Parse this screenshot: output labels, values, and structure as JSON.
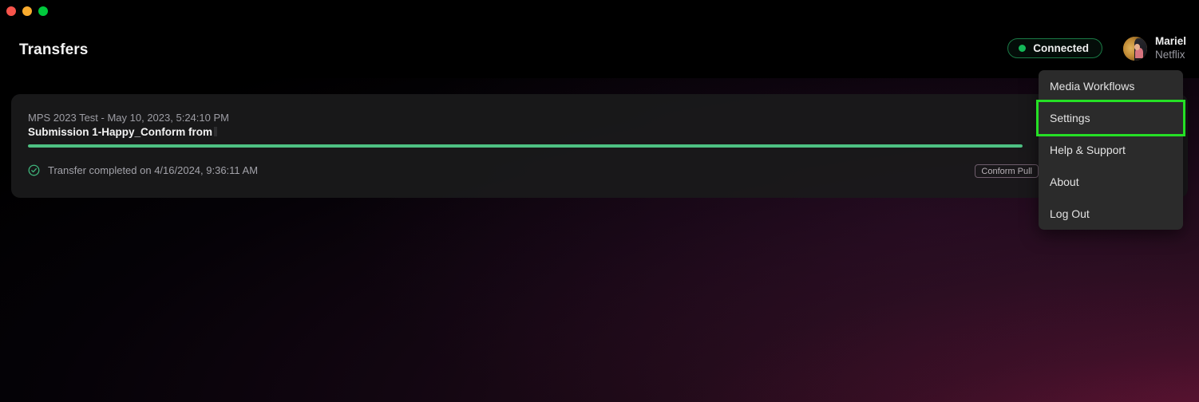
{
  "window": {
    "traffic_lights": [
      {
        "name": "close",
        "color": "#f8544b"
      },
      {
        "name": "minimize",
        "color": "#f9ab2e"
      },
      {
        "name": "zoom",
        "color": "#00c93c"
      }
    ]
  },
  "header": {
    "title": "Transfers",
    "connection": {
      "label": "Connected",
      "status_color": "#14b858",
      "border_color": "#1a7a45"
    },
    "user": {
      "name": "Mariel",
      "organization": "Netflix",
      "avatar_icon": "user-avatar-photo"
    }
  },
  "transfers": [
    {
      "meta": "MPS 2023 Test - May 10, 2023, 5:24:10 PM",
      "title": "Submission 1-Happy_Conform from",
      "progress_percent": 100,
      "progress_color": "#4ec183",
      "status_icon": "check-circle-icon",
      "status_text": "Transfer completed on 4/16/2024, 9:36:11 AM",
      "tag": "Conform Pull"
    }
  ],
  "menu": {
    "items": [
      {
        "label": "Media Workflows",
        "highlighted": false
      },
      {
        "label": "Settings",
        "highlighted": true
      },
      {
        "label": "Help & Support",
        "highlighted": false
      },
      {
        "label": "About",
        "highlighted": false
      },
      {
        "label": "Log Out",
        "highlighted": false
      }
    ],
    "highlight_color": "#25e025",
    "background_color": "#2b2b2b"
  }
}
